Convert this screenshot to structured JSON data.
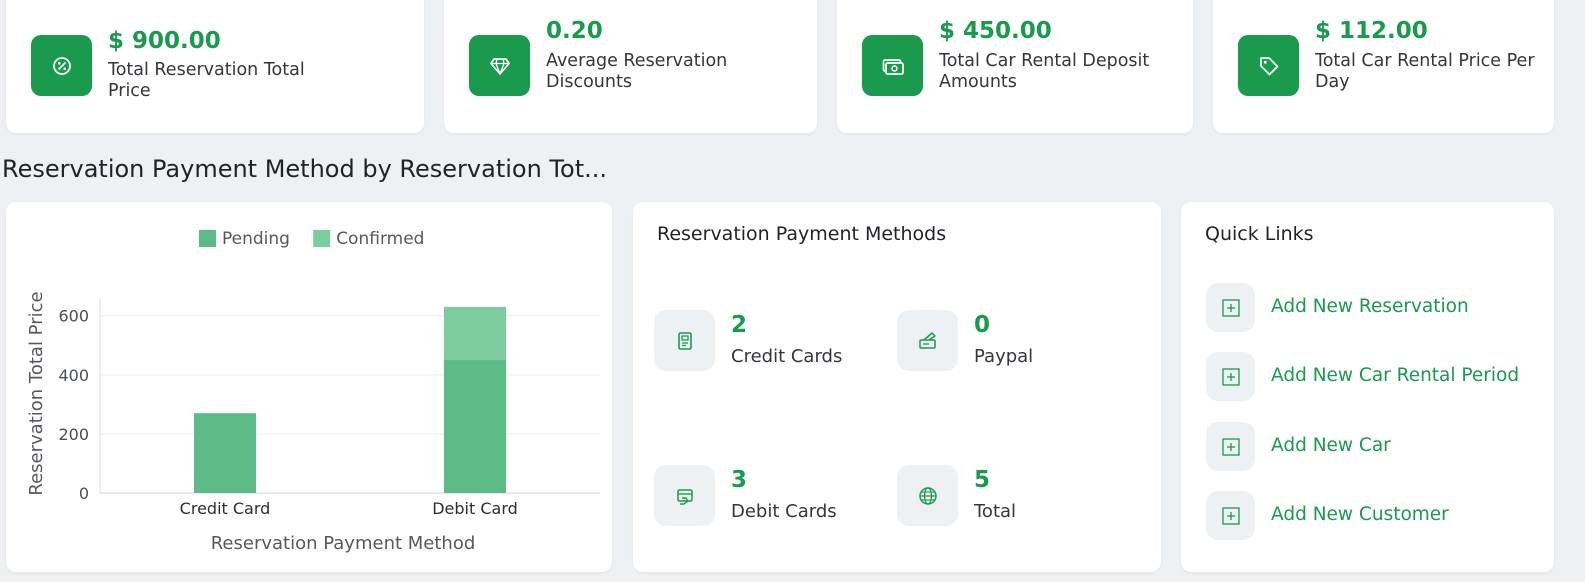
{
  "colors": {
    "accent": "#1a9a4d",
    "pending": "#5cbb87",
    "confirmed": "#7dcca0",
    "icon_bg": "#eef1f4"
  },
  "kpis": [
    {
      "value": "$ 900.00",
      "label": "Total Reservation Total Price",
      "icon": "percent-badge-icon"
    },
    {
      "value": "0.20",
      "label": "Average Reservation Discounts",
      "icon": "diamond-icon"
    },
    {
      "value": "$ 450.00",
      "label": "Total Car Rental Deposit Amounts",
      "icon": "money-icon"
    },
    {
      "value": "$ 112.00",
      "label": "Total Car Rental Price Per Day",
      "icon": "tag-icon"
    }
  ],
  "section_title": "Reservation Payment Method by Reservation Tot...",
  "chart_data": {
    "type": "bar",
    "stacked": true,
    "categories": [
      "Credit Card",
      "Debit Card"
    ],
    "series": [
      {
        "name": "Pending",
        "values": [
          270,
          450
        ],
        "color": "#5cbb87"
      },
      {
        "name": "Confirmed",
        "values": [
          0,
          180
        ],
        "color": "#7dcca0"
      }
    ],
    "xlabel": "Reservation Payment Method",
    "ylabel": "Reservation Total Price",
    "ylim": [
      0,
      660
    ],
    "yticks": [
      0,
      200,
      400,
      600
    ],
    "grid": true,
    "legend_position": "top"
  },
  "payment_methods": {
    "title": "Reservation Payment Methods",
    "items": [
      {
        "count": "2",
        "label": "Credit Cards",
        "icon": "credit-card-icon"
      },
      {
        "count": "0",
        "label": "Paypal",
        "icon": "paypal-icon"
      },
      {
        "count": "3",
        "label": "Debit Cards",
        "icon": "debit-card-icon"
      },
      {
        "count": "5",
        "label": "Total",
        "icon": "globe-icon"
      }
    ]
  },
  "quick_links": {
    "title": "Quick Links",
    "items": [
      {
        "label": "Add New Reservation"
      },
      {
        "label": "Add New Car Rental Period"
      },
      {
        "label": "Add New Car"
      },
      {
        "label": "Add New Customer"
      }
    ]
  }
}
